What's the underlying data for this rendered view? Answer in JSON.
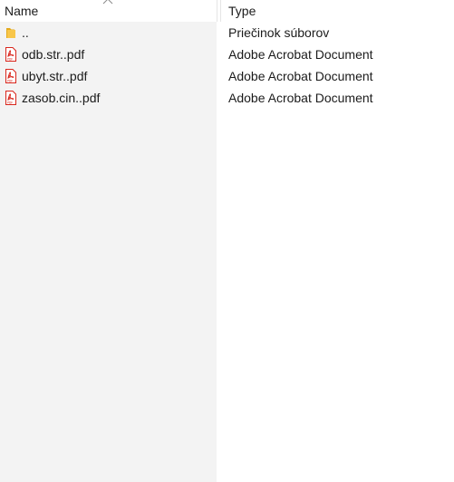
{
  "header": {
    "name_label": "Name",
    "type_label": "Type",
    "sort_indicator_icon": "chevron-up-icon"
  },
  "rows": [
    {
      "name": "..",
      "type": "Priečinok súborov",
      "icon": "folder-icon"
    },
    {
      "name": "odb.str..pdf",
      "type": "Adobe Acrobat Document",
      "icon": "pdf-file-icon"
    },
    {
      "name": "ubyt.str..pdf",
      "type": "Adobe Acrobat Document",
      "icon": "pdf-file-icon"
    },
    {
      "name": "zasob.cin..pdf",
      "type": "Adobe Acrobat Document",
      "icon": "pdf-file-icon"
    }
  ],
  "colors": {
    "name_column_background": "#f3f3f3",
    "pdf_icon_red": "#d9261c",
    "folder_yellow": "#f8c64a"
  }
}
